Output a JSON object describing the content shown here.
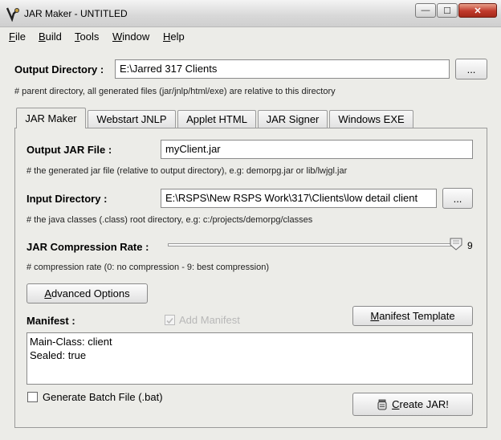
{
  "window": {
    "title": "JAR Maker - UNTITLED",
    "min_glyph": "—",
    "max_glyph": "☐",
    "close_glyph": "✕"
  },
  "menu": [
    {
      "key": "F",
      "rest": "ile"
    },
    {
      "key": "B",
      "rest": "uild"
    },
    {
      "key": "T",
      "rest": "ools"
    },
    {
      "key": "W",
      "rest": "indow"
    },
    {
      "key": "H",
      "rest": "elp"
    }
  ],
  "output_dir": {
    "label": "Output Directory :",
    "value": "E:\\Jarred 317 Clients",
    "browse": "...",
    "note": "# parent directory, all generated files (jar/jnlp/html/exe) are relative to this directory"
  },
  "tabs": [
    "JAR Maker",
    "Webstart JNLP",
    "Applet HTML",
    "JAR Signer",
    "Windows EXE"
  ],
  "jar_maker": {
    "output_jar_label": "Output JAR File :",
    "output_jar_value": "myClient.jar",
    "output_jar_note": "# the generated jar file (relative to output directory), e.g: demorpg.jar or lib/lwjgl.jar",
    "input_dir_label": "Input Directory :",
    "input_dir_value": "E:\\RSPS\\New RSPS Work\\317\\Clients\\low detail client",
    "input_dir_browse": "...",
    "input_dir_note": "# the java classes (.class) root directory, e.g: c:/projects/demorpg/classes",
    "compression_label": "JAR Compression Rate :",
    "compression_value": "9",
    "compression_max": 9,
    "compression_note": "# compression rate (0: no compression - 9: best compression)",
    "advanced_key": "A",
    "advanced_rest": "dvanced Options",
    "manifest_label": "Manifest :",
    "add_manifest_label": "Add Manifest",
    "manifest_template_key": "M",
    "manifest_template_rest": "anifest Template",
    "manifest_lines": [
      "Main-Class: client",
      "Sealed: true"
    ],
    "batch_label": "Generate Batch File (.bat)",
    "create_key": "C",
    "create_rest": "reate JAR!"
  }
}
